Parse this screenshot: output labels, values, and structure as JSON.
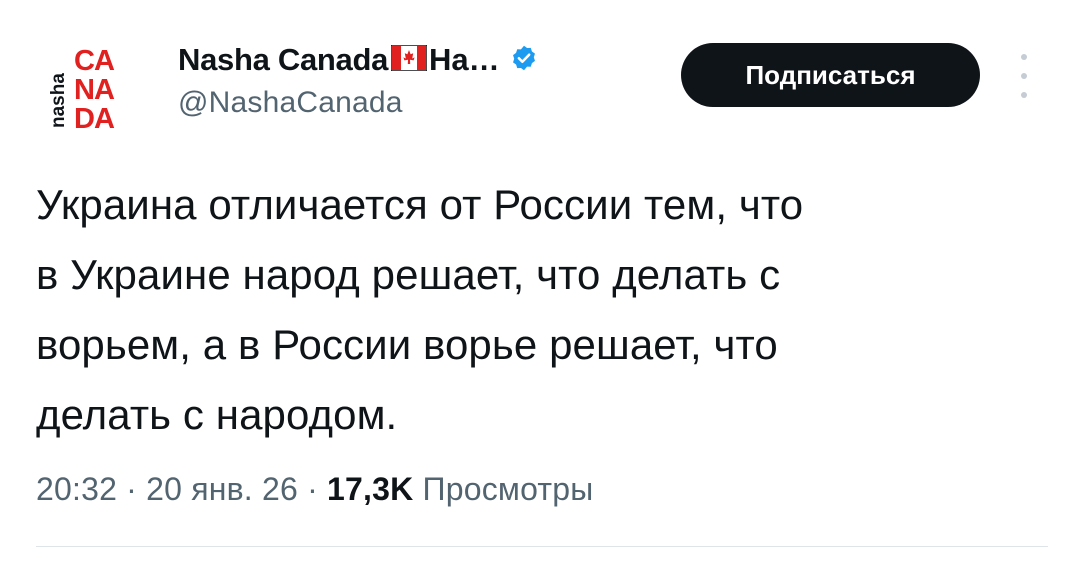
{
  "author": {
    "avatar_text": [
      "nasha",
      "CA",
      "NA",
      "DA"
    ],
    "display_name": "Nasha Canada",
    "name_suffix": "Ha…",
    "handle": "@NashaCanada",
    "flag": "canada-flag-icon",
    "verified": "verified-badge-icon"
  },
  "actions": {
    "subscribe_label": "Подписаться",
    "more": "more-vertical-icon"
  },
  "tweet": {
    "lines": [
      "Украина отличается от России тем, что",
      "в Украине народ решает, что делать с",
      "ворьем, а в России ворье решает, что",
      "делать с народом."
    ]
  },
  "meta": {
    "time": "20:32",
    "sep1": " · ",
    "date": "20 янв. 26",
    "sep2": " · ",
    "views_count": "17,3K",
    "views_label": "Просмотры"
  },
  "colors": {
    "text": "#0f1419",
    "secondary": "#536471",
    "accent_red": "#e0211f",
    "verified_blue": "#1d9bf0",
    "button_bg": "#0f1419"
  }
}
